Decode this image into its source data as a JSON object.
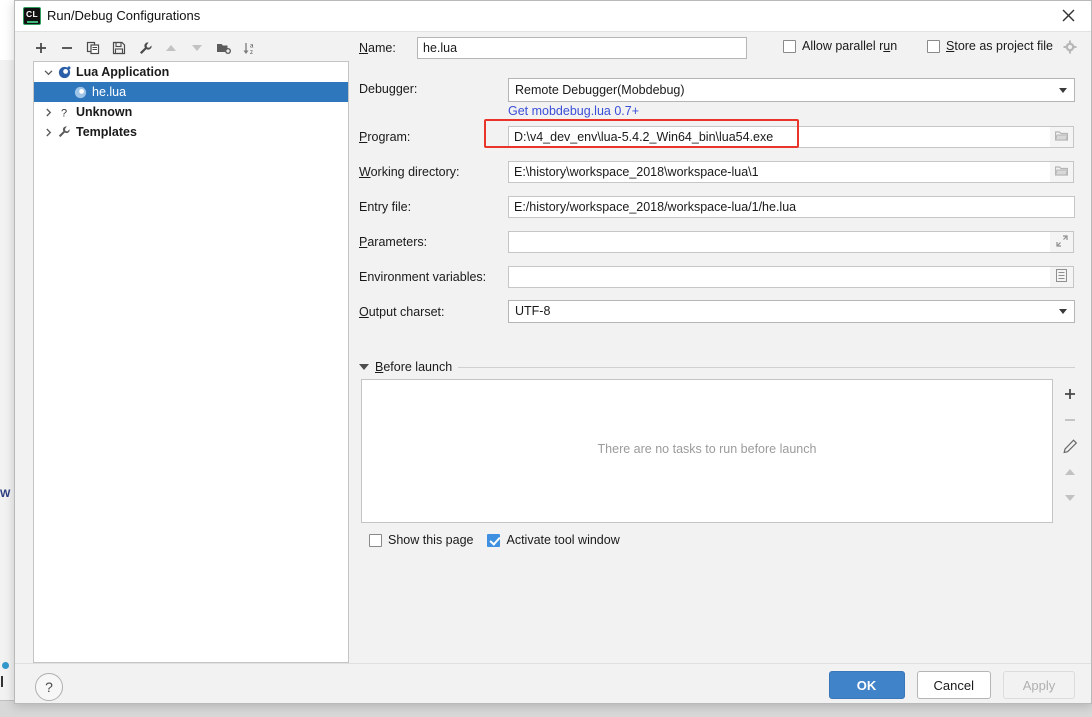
{
  "window": {
    "title": "Run/Debug Configurations",
    "app_icon": "clion-icon",
    "close_label": "✕"
  },
  "toolbar": {
    "items": [
      {
        "name": "add-configuration-button",
        "icon": "plus-icon"
      },
      {
        "name": "remove-configuration-button",
        "icon": "minus-icon"
      },
      {
        "name": "copy-configuration-button",
        "icon": "copy-icon"
      },
      {
        "name": "save-configuration-button",
        "icon": "save-icon"
      },
      {
        "name": "edit-templates-button",
        "icon": "wrench-icon"
      },
      {
        "name": "move-up-button",
        "icon": "arrow-up-icon"
      },
      {
        "name": "move-down-button",
        "icon": "arrow-down-icon"
      },
      {
        "name": "new-folder-button",
        "icon": "folder-add-icon"
      },
      {
        "name": "sort-configurations-button",
        "icon": "sort-az-icon"
      }
    ]
  },
  "tree": {
    "nodes": [
      {
        "label": "Lua Application",
        "icon": "lua-icon",
        "expanded": true,
        "selected": false,
        "child": false
      },
      {
        "label": "he.lua",
        "icon": "lua-icon",
        "expanded": null,
        "selected": true,
        "child": true
      },
      {
        "label": "Unknown",
        "icon": "question-icon",
        "expanded": false,
        "selected": false,
        "child": false
      },
      {
        "label": "Templates",
        "icon": "wrench-icon",
        "expanded": false,
        "selected": false,
        "child": false
      }
    ]
  },
  "form": {
    "name": {
      "label_pre": "",
      "label_mn": "N",
      "label_post": "ame:",
      "value": "he.lua"
    },
    "allow_parallel_run": {
      "label_pre": "Allow parallel r",
      "label_mn": "u",
      "label_post": "n",
      "checked": false
    },
    "store_as_project_file": {
      "label_pre": "",
      "label_mn": "S",
      "label_post": "tore as project file",
      "checked": false,
      "gear_icon": "gear-icon"
    },
    "debugger": {
      "label": "Debugger:",
      "value": "Remote Debugger(Mobdebug)",
      "link": "Get mobdebug.lua 0.7+"
    },
    "program": {
      "label_pre": "",
      "label_mn": "P",
      "label_post": "rogram:",
      "value": "D:\\v4_dev_env\\lua-5.4.2_Win64_bin\\lua54.exe",
      "browse_icon": "folder-icon",
      "highlighted": true,
      "highlight_color": "#e8342a"
    },
    "working_directory": {
      "label_pre": "",
      "label_mn": "W",
      "label_post": "orking directory:",
      "value": "E:\\history\\workspace_2018\\workspace-lua\\1",
      "browse_icon": "folder-icon"
    },
    "entry_file": {
      "label": "Entry file:",
      "value": "E:/history/workspace_2018/workspace-lua/1/he.lua"
    },
    "parameters": {
      "label_pre": "",
      "label_mn": "P",
      "label_post": "arameters:",
      "value": "",
      "expand_icon": "expand-icon"
    },
    "environment_variables": {
      "label": "Environment variables:",
      "value": "",
      "list_icon": "list-icon"
    },
    "output_charset": {
      "label_pre": "",
      "label_mn": "O",
      "label_post": "utput charset:",
      "value": "UTF-8"
    }
  },
  "before_launch": {
    "title_pre": "",
    "title_mn": "B",
    "title_post": "efore launch",
    "expanded": true,
    "empty_text": "There are no tasks to run before launch",
    "toolbar": [
      {
        "name": "add-task-button",
        "icon": "plus-icon"
      },
      {
        "name": "remove-task-button",
        "icon": "minus-icon"
      },
      {
        "name": "edit-task-button",
        "icon": "pencil-icon"
      },
      {
        "name": "move-task-up-button",
        "icon": "arrow-up-icon"
      },
      {
        "name": "move-task-down-button",
        "icon": "arrow-down-icon"
      }
    ]
  },
  "bottom_options": {
    "show_this_page": {
      "label": "Show this page",
      "checked": false
    },
    "activate_tool_window": {
      "label": "Activate tool window",
      "checked": true
    }
  },
  "footer": {
    "help_label": "?",
    "ok_label": "OK",
    "cancel_label": "Cancel",
    "apply_label": "Apply",
    "apply_disabled": true
  },
  "background": {
    "fragment_text": "W"
  }
}
